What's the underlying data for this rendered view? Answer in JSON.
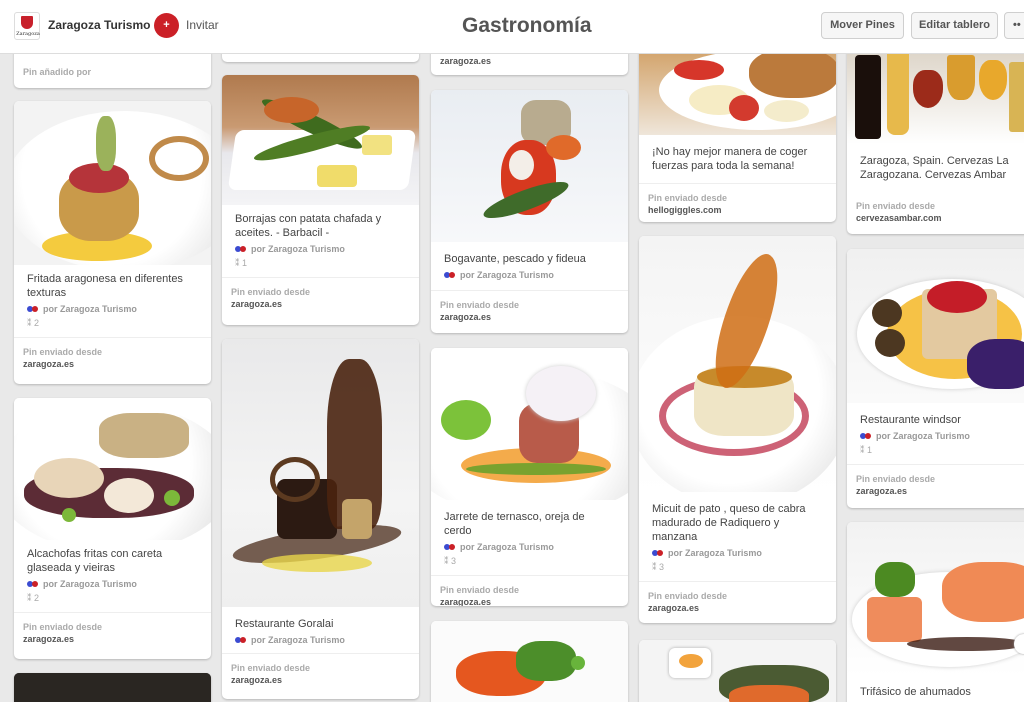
{
  "header": {
    "owner": "Zaragoza Turismo",
    "logo_caption": "Zaragoza",
    "invite_icon": "+",
    "invite": "Invitar",
    "title": "Gastronomía",
    "move_pins": "Mover Pines",
    "edit_board": "Editar tablero",
    "more": "••"
  },
  "pins": {
    "c1_top": {
      "src_label": "Pin añadido por"
    },
    "fritada": {
      "desc": "Fritada aragonesa en diferentes texturas",
      "by": "por Zaragoza Turismo",
      "stat": "⁑ 2",
      "src_label": "Pin enviado desde",
      "src": "zaragoza.es"
    },
    "alcachofas": {
      "desc": "Alcachofas fritas con careta glaseada y vieiras",
      "by": "por Zaragoza Turismo",
      "stat": "⁑ 2",
      "src_label": "Pin enviado desde",
      "src": "zaragoza.es"
    },
    "borrajas": {
      "desc": "Borrajas con patata chafada y aceites. - Barbacil -",
      "by": "por Zaragoza Turismo",
      "stat": "⁑ 1",
      "src_label": "Pin enviado desde",
      "src": "zaragoza.es"
    },
    "goralai": {
      "desc": "Restaurante Goralai",
      "by": "por Zaragoza Turismo",
      "src_label": "Pin enviado desde",
      "src": "zaragoza.es"
    },
    "c3_top": {
      "src": "zaragoza.es"
    },
    "bogavante": {
      "desc": "Bogavante, pescado y fideua",
      "by": "por Zaragoza Turismo",
      "src_label": "Pin enviado desde",
      "src": "zaragoza.es"
    },
    "jarrete": {
      "desc": "Jarrete de ternasco, oreja de cerdo",
      "by": "por Zaragoza Turismo",
      "stat": "⁑ 3",
      "src_label": "Pin enviado desde",
      "src": "zaragoza.es"
    },
    "pancakes": {
      "desc": "¡No hay mejor manera de coger fuerzas para toda la semana!",
      "src_label": "Pin enviado desde",
      "src": "hellogiggles.com"
    },
    "micuit": {
      "desc": "Micuit de pato , queso de cabra madurado de Radiquero y manzana",
      "by": "por Zaragoza Turismo",
      "stat": "⁑ 3",
      "src_label": "Pin enviado desde",
      "src": "zaragoza.es"
    },
    "cervezas": {
      "desc": "Zaragoza, Spain. Cervezas La Zaragozana. Cervezas Ambar",
      "src_label": "Pin enviado desde",
      "src": "cervezasambar.com"
    },
    "windsor": {
      "desc": "Restaurante windsor",
      "by": "por Zaragoza Turismo",
      "stat": "⁑ 1",
      "src_label": "Pin enviado desde",
      "src": "zaragoza.es"
    },
    "trifasico": {
      "desc": "Trifásico de ahumados"
    }
  },
  "colors": {
    "accent_red": "#cb2027",
    "background": "#e9e9e9"
  }
}
